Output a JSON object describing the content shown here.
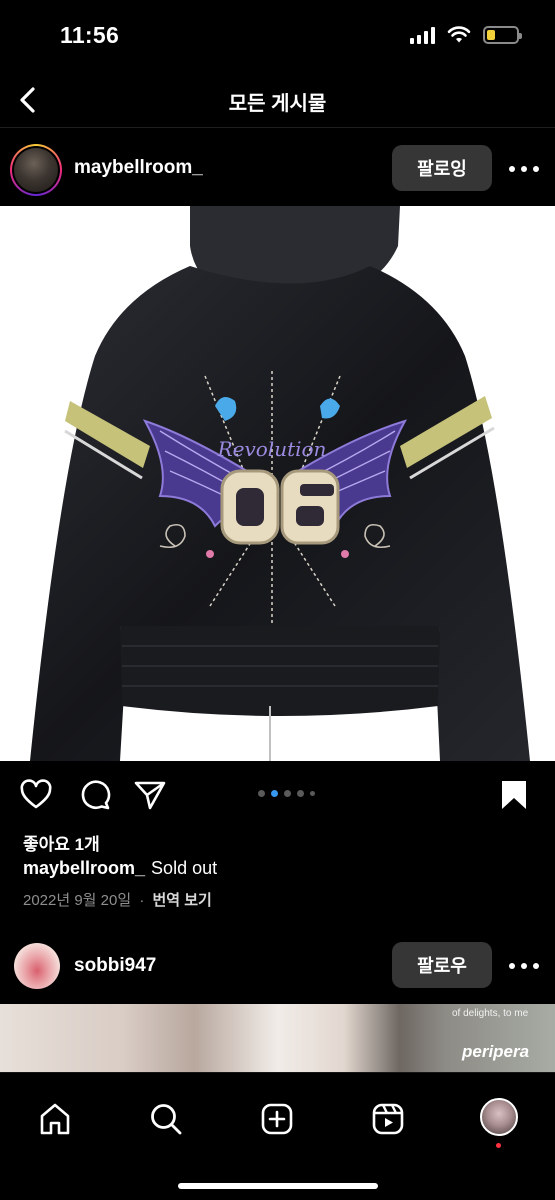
{
  "status_bar": {
    "time": "11:56",
    "icons": [
      "signal-icon",
      "wifi-icon",
      "battery-icon"
    ],
    "battery_level_fraction": 0.3,
    "battery_color": "#f2d13a"
  },
  "header": {
    "title": "모든 게시물",
    "back_icon": "chevron-left-icon"
  },
  "post": {
    "username": "maybellroom_",
    "follow_label": "팔로잉",
    "more_icon": "more-horizontal-icon",
    "image_alt": "Black velour hoodie with winged 06 embroidery",
    "image_text": "06",
    "carousel": {
      "count": 5,
      "active_index": 1
    },
    "actions": [
      "heart-icon",
      "comment-icon",
      "share-icon",
      "bookmark-icon"
    ],
    "likes": "좋아요 1개",
    "caption_user": "maybellroom_",
    "caption_text": "Sold out",
    "date": "2022년 9월 20일",
    "separator": "·",
    "translate_label": "번역 보기"
  },
  "next_post": {
    "username": "sobbi947",
    "follow_label": "팔로우",
    "more_icon": "more-horizontal-icon",
    "image_text_small": "of delights, to me",
    "image_brand": "peripera"
  },
  "tab_bar": {
    "tabs": [
      "home-icon",
      "search-icon",
      "create-icon",
      "reels-icon",
      "profile-avatar"
    ],
    "accent_dot_color": "#ff3040"
  },
  "colors": {
    "background": "#000000",
    "button_bg": "#363636",
    "muted_text": "#8e8e8e",
    "carousel_active": "#3897f0"
  }
}
